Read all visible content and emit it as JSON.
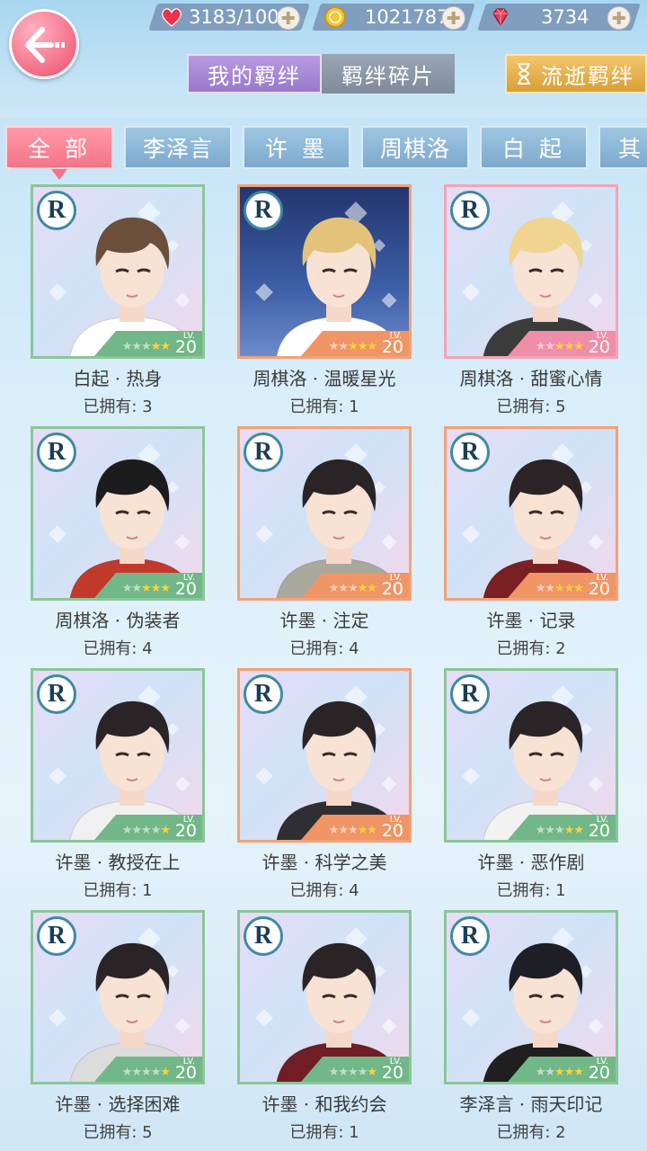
{
  "resources": [
    {
      "icon": "heart-icon",
      "value": "3183/100"
    },
    {
      "icon": "gold-coin-icon",
      "value": "1021787"
    },
    {
      "icon": "ruby-gem-icon",
      "value": "3734"
    }
  ],
  "main_tabs": {
    "my_bonds": "我的羁绊",
    "fragments": "羁绊碎片",
    "lost_bonds": "流逝羁绊"
  },
  "filter_tabs": [
    "全 部",
    "李泽言",
    "许 墨",
    "周棋洛",
    "白 起",
    "其"
  ],
  "cards": [
    {
      "rarity": "R",
      "name": "白起 · 热身",
      "owned": "已拥有: 3",
      "level": "20",
      "stars": 2,
      "hair": "#6b4f3a",
      "shirt": "#ffffff",
      "variant": ""
    },
    {
      "rarity": "R",
      "name": "周棋洛 · 温暖星光",
      "owned": "已拥有: 1",
      "level": "20",
      "stars": 3,
      "hair": "#e3c37a",
      "shirt": "#ffffff",
      "variant": "night orange"
    },
    {
      "rarity": "R",
      "name": "周棋洛 · 甜蜜心情",
      "owned": "已拥有: 5",
      "level": "20",
      "stars": 3,
      "hair": "#f0d48f",
      "shirt": "#3b3b3b",
      "variant": "pink"
    },
    {
      "rarity": "R",
      "name": "周棋洛 · 伪装者",
      "owned": "已拥有: 4",
      "level": "20",
      "stars": 3,
      "hair": "#1c1c1c",
      "shirt": "#c0392b",
      "variant": ""
    },
    {
      "rarity": "R",
      "name": "许墨 · 注定",
      "owned": "已拥有: 4",
      "level": "20",
      "stars": 2,
      "hair": "#2a2426",
      "shirt": "#a8a89c",
      "variant": "orange"
    },
    {
      "rarity": "R",
      "name": "许墨 · 记录",
      "owned": "已拥有: 2",
      "level": "20",
      "stars": 3,
      "hair": "#2a2426",
      "shirt": "#7a1f22",
      "variant": "orange"
    },
    {
      "rarity": "R",
      "name": "许墨 · 教授在上",
      "owned": "已拥有: 1",
      "level": "20",
      "stars": 1,
      "hair": "#2a2426",
      "shirt": "#f0f0f0",
      "variant": ""
    },
    {
      "rarity": "R",
      "name": "许墨 · 科学之美",
      "owned": "已拥有: 4",
      "level": "20",
      "stars": 2,
      "hair": "#2a2426",
      "shirt": "#2f2f33",
      "variant": "orange"
    },
    {
      "rarity": "R",
      "name": "许墨 · 恶作剧",
      "owned": "已拥有: 1",
      "level": "20",
      "stars": 2,
      "hair": "#2a2426",
      "shirt": "#f2f2f2",
      "variant": ""
    },
    {
      "rarity": "R",
      "name": "许墨 · 选择困难",
      "owned": "已拥有: 5",
      "level": "20",
      "stars": 1,
      "hair": "#2a2426",
      "shirt": "#dcdcdc",
      "variant": ""
    },
    {
      "rarity": "R",
      "name": "许墨 · 和我约会",
      "owned": "已拥有: 1",
      "level": "20",
      "stars": 1,
      "hair": "#2a2426",
      "shirt": "#6e1e24",
      "variant": ""
    },
    {
      "rarity": "R",
      "name": "李泽言 · 雨天印记",
      "owned": "已拥有: 2",
      "level": "20",
      "stars": 3,
      "hair": "#1e1e26",
      "shirt": "#1f1f1f",
      "variant": ""
    }
  ]
}
